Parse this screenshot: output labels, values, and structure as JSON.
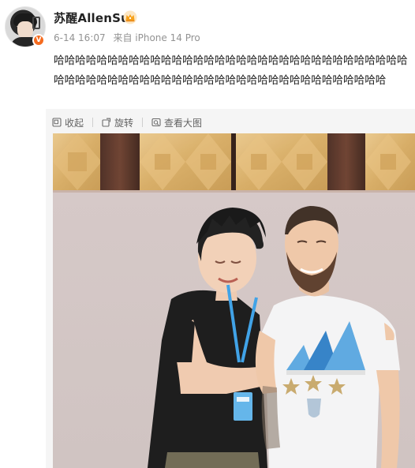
{
  "user": {
    "name": "苏醒AllenSu",
    "verified_mark": "V"
  },
  "meta": {
    "time": "6-14 16:07",
    "source": "来自 iPhone 14 Pro"
  },
  "post": {
    "text": "哈哈哈哈哈哈哈哈哈哈哈哈哈哈哈哈哈哈哈哈哈哈哈哈哈哈哈哈哈哈哈哈哈哈哈哈哈哈哈哈哈哈哈哈哈哈哈哈哈哈哈哈哈哈哈哈哈哈哈哈哈哈哈哈"
  },
  "toolbar": {
    "collapse_label": "收起",
    "rotate_label": "旋转",
    "view_large_label": "查看大图"
  },
  "icons": {
    "collapse": "collapse-icon",
    "rotate": "rotate-icon",
    "view_large": "view-large-icon",
    "crown": "crown-icon"
  },
  "colors": {
    "username": "#222222",
    "meta": "#939393",
    "verified_badge": "#f56b1f",
    "crown": "#f7a21b",
    "panel_bg": "#f5f5f5"
  }
}
